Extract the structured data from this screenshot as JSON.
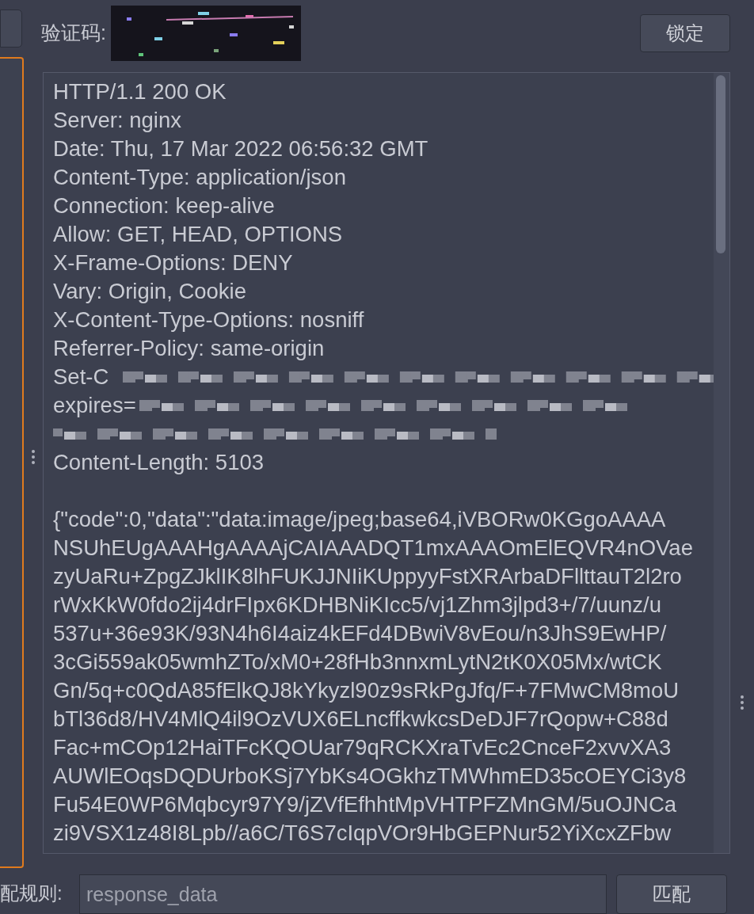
{
  "captcha": {
    "label": "验证码:"
  },
  "lock_button": "锁定",
  "response": {
    "lines": [
      {
        "kind": "text",
        "text": "HTTP/1.1 200 OK"
      },
      {
        "kind": "text",
        "text": "Server: nginx"
      },
      {
        "kind": "text",
        "text": "Date: Thu, 17 Mar 2022 06:56:32 GMT"
      },
      {
        "kind": "text",
        "text": "Content-Type: application/json"
      },
      {
        "kind": "text",
        "text": "Connection: keep-alive"
      },
      {
        "kind": "text",
        "text": "Allow: GET, HEAD, OPTIONS"
      },
      {
        "kind": "text",
        "text": "X-Frame-Options: DENY"
      },
      {
        "kind": "text",
        "text": "Vary: Origin, Cookie"
      },
      {
        "kind": "text",
        "text": "X-Content-Type-Options: nosniff"
      },
      {
        "kind": "text",
        "text": "Referrer-Policy: same-origin"
      },
      {
        "kind": "redacted",
        "text": "Set-C"
      },
      {
        "kind": "redacted",
        "text": "expires="
      },
      {
        "kind": "redacted"
      },
      {
        "kind": "text",
        "text": "Content-Length: 5103"
      },
      {
        "kind": "blank"
      },
      {
        "kind": "text",
        "text": "{\"code\":0,\"data\":\"data:image/jpeg;base64,iVBORw0KGgoAAAA"
      },
      {
        "kind": "text",
        "text": "NSUhEUgAAAHgAAAAjCAIAAADQT1mxAAAOmElEQVR4nOVae"
      },
      {
        "kind": "text",
        "text": "zyUaRu+ZpgZJklIK8lhFUKJJNIiKUppyyFstXRArbaDFllttauT2l2ro"
      },
      {
        "kind": "text",
        "text": "rWxKkW0fdo2ij4drFIpx6KDHBNiKIcc5/vj1Zhm3jlpd3+/7/uunz/u"
      },
      {
        "kind": "text",
        "text": "537u+36e93K/93N4h6I4aiz4kEFd4DBwiV8vEou/n3JhS9EwHP/"
      },
      {
        "kind": "text",
        "text": "3cGi559ak05wmhZTo/xM0+28fHb3nnxmLytN2tK0X05Mx/wtCK"
      },
      {
        "kind": "text",
        "text": "Gn/5q+c0QdA85fElkQJ8kYkyzl90z9sRkPgJfq/F+7FMwCM8moU"
      },
      {
        "kind": "text",
        "text": "bTl36d8/HV4MlQ4il9OzVUX6ELncffkwkcsDeDJF7rQopw+C88d"
      },
      {
        "kind": "text",
        "text": "Fac+mCOp12HaiTFcKQOUar79qRCKXraTvEc2CnceF2xvvXA3"
      },
      {
        "kind": "text",
        "text": "AUWlEOqsDQDUrboKSj7YbKs4OGkhzTMWhmED35cOEYCi3y8"
      },
      {
        "kind": "text",
        "text": "Fu54E0WP6Mqbcyr97Y9/jZVfEfhhtMpVHTPFZMnGM/5uOJNCa"
      },
      {
        "kind": "text",
        "text": "zi9VSX1z48I8Lpb//a6C/T6S7cIqpVOr9HbGEPNur52YiXcxZFbw"
      }
    ]
  },
  "match_rule": {
    "label": "配规则:",
    "value": "response_data"
  },
  "match_button": "匹配"
}
